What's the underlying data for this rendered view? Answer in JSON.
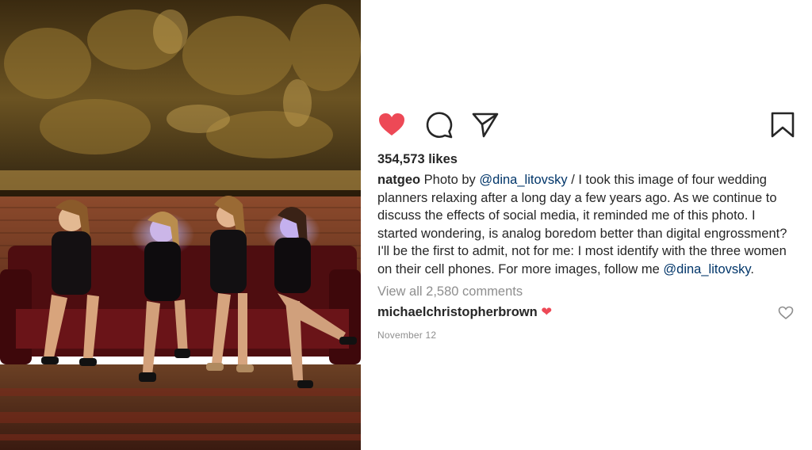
{
  "post": {
    "likes": "354,573 likes",
    "caption": {
      "username": "natgeo",
      "part1": " Photo by ",
      "mention1": "@dina_litovsky",
      "part2": " / I took this image of four wedding planners relaxing after a long day a few years ago. As we continue to discuss the effects of social media, it reminded me of this photo. I started wondering, is analog boredom better than digital engrossment? I'll be the first to admit, not for me: I most identify with the three women on their cell phones. For more images, follow me ",
      "mention2": "@dina_litovsky",
      "part3": "."
    },
    "view_all_comments": "View all 2,580 comments",
    "comment": {
      "username": "michaelchristopherbrown",
      "text": "❤"
    },
    "date": "November 12"
  },
  "icons": {
    "like": "heart-filled-icon",
    "comment": "speech-bubble-icon",
    "share": "paper-plane-icon",
    "save": "bookmark-icon",
    "comment_like": "heart-outline-icon"
  },
  "colors": {
    "like_red": "#ed4956",
    "mention": "#003569",
    "muted": "#8e8e8e",
    "text": "#262626"
  }
}
